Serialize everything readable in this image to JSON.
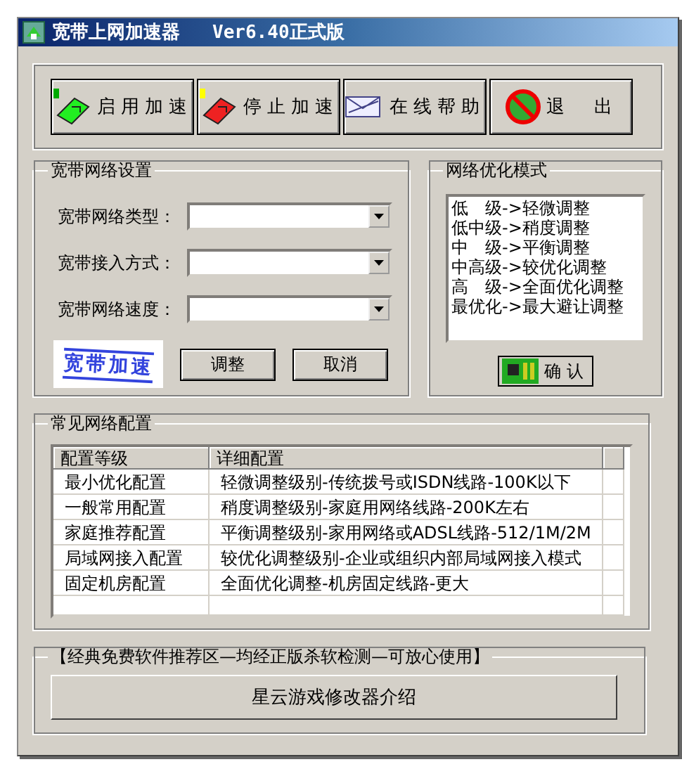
{
  "window": {
    "title": "宽带上网加速器",
    "version": "Ver6.40正式版"
  },
  "toolbar": [
    {
      "label": "启用加速",
      "kind": "start"
    },
    {
      "label": "停止加速",
      "kind": "stop"
    },
    {
      "label": "在线帮助",
      "kind": "help"
    },
    {
      "label": "退　出",
      "kind": "exit"
    }
  ],
  "settings": {
    "title": "宽带网络设置",
    "fields": [
      {
        "label": "宽带网络类型："
      },
      {
        "label": "宽带接入方式："
      },
      {
        "label": "宽带网络速度："
      }
    ],
    "logo": "宽带加速",
    "buttons": [
      "调整",
      "取消"
    ]
  },
  "mode": {
    "title": "网络优化模式",
    "items": [
      {
        "label": "低　级->轻微调整",
        "selected": false
      },
      {
        "label": "低中级->稍度调整",
        "selected": false
      },
      {
        "label": "中　级->平衡调整",
        "selected": false
      },
      {
        "label": "中高级->较优化调整",
        "selected": false
      },
      {
        "label": "高　级->全面优化调整",
        "selected": false
      },
      {
        "label": "最优化->最大避让调整",
        "selected": false
      }
    ],
    "confirm": "确 认"
  },
  "configs": {
    "title": "常见网络配置",
    "columns": [
      "配置等级",
      "详细配置"
    ],
    "rows": [
      [
        "最小优化配置",
        "轻微调整级别-传统拨号或ISDN线路-100K以下"
      ],
      [
        "一般常用配置",
        "稍度调整级别-家庭用网络线路-200K左右"
      ],
      [
        "家庭推荐配置",
        "平衡调整级别-家用网络或ADSL线路-512/1M/2M"
      ],
      [
        "局域网接入配置",
        "较优化调整级别-企业或组织内部局域网接入模式"
      ],
      [
        "固定机房配置",
        "全面优化调整-机房固定线路-更大"
      ]
    ]
  },
  "recommend": {
    "title": "【经典免费软件推荐区—均经正版杀软检测—可放心使用】",
    "button": "星云游戏修改器介绍"
  }
}
